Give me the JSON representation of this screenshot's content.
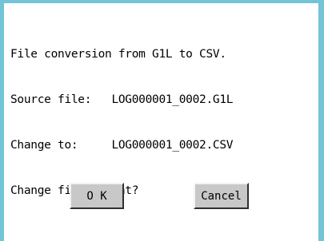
{
  "dialog": {
    "lines": [
      "File conversion from G1L to CSV.",
      "Source file:   LOG000001_0002.G1L",
      "Change to:     LOG000001_0002.CSV",
      "Change file format?"
    ],
    "ok_label": "O K",
    "cancel_label": "Cancel"
  },
  "colors": {
    "frame": "#72c4d6",
    "button_face": "#c8c8c8",
    "background": "#ffffff"
  }
}
